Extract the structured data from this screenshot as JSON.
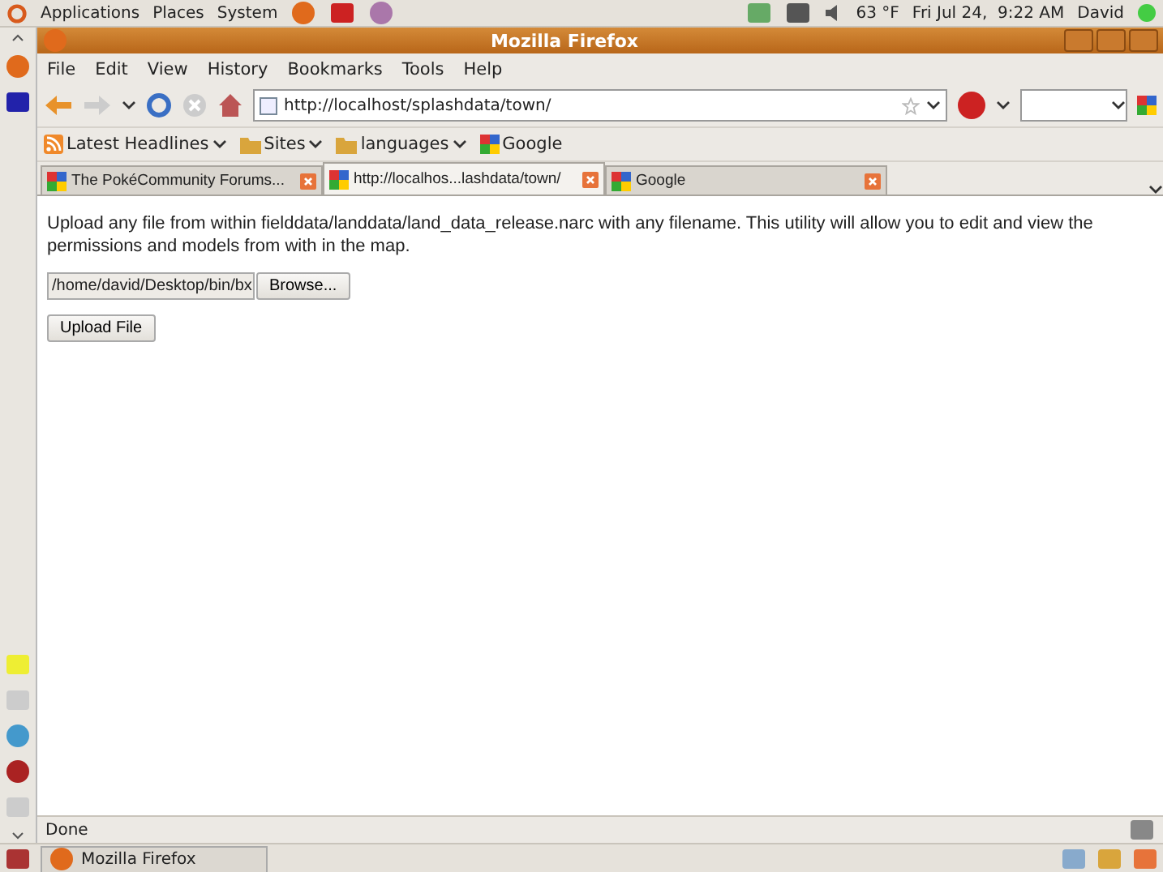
{
  "top_panel": {
    "menus": [
      "Applications",
      "Places",
      "System"
    ],
    "weather": "63 °F",
    "clock": "Fri Jul 24,  9:22 AM",
    "user": "David"
  },
  "window": {
    "title": "Mozilla Firefox"
  },
  "menu": [
    "File",
    "Edit",
    "View",
    "History",
    "Bookmarks",
    "Tools",
    "Help"
  ],
  "address_bar": {
    "value": "http://localhost/splashdata/town/"
  },
  "bookmarks": [
    {
      "label": "Latest Headlines",
      "kind": "feed"
    },
    {
      "label": "Sites",
      "kind": "folder"
    },
    {
      "label": "languages",
      "kind": "folder"
    },
    {
      "label": "Google",
      "kind": "google"
    }
  ],
  "tabs": [
    {
      "title": "The PokéCommunity Forums...",
      "selected": false
    },
    {
      "title": "http://localhos...lashdata/town/",
      "selected": true
    },
    {
      "title": "Google",
      "selected": false
    }
  ],
  "content": {
    "description": "Upload any file from within fielddata/landdata/land_data_release.narc with any filename. This utility will allow you to edit and view the permissions and models from with in the map.",
    "file_field": "/home/david/Desktop/bin/bx",
    "browse_button": "Browse...",
    "upload_button": "Upload File"
  },
  "status_bar": {
    "text": "Done"
  },
  "taskbar": [
    {
      "label": "Mozilla Firefox"
    }
  ]
}
